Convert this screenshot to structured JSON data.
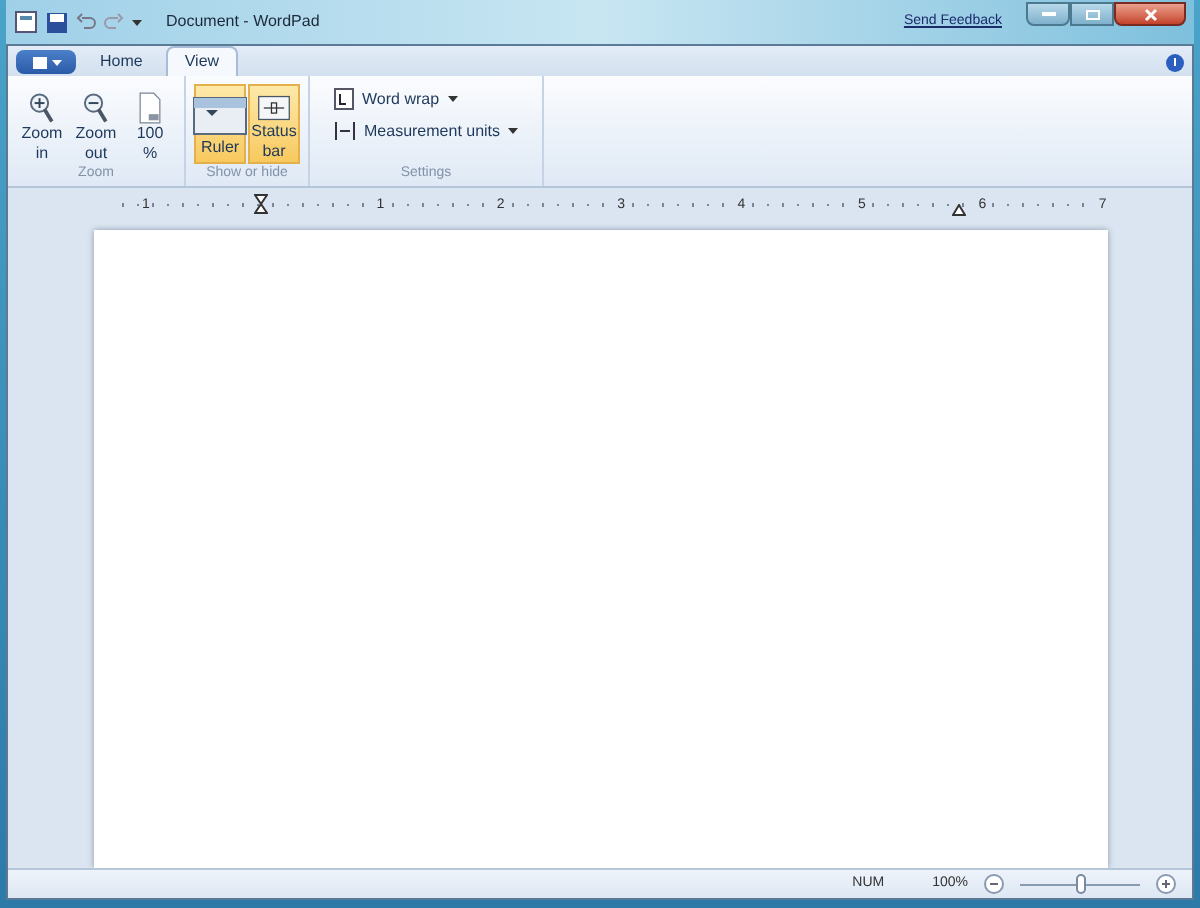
{
  "window": {
    "title": "Document - WordPad",
    "send_feedback": "Send Feedback"
  },
  "tabs": [
    {
      "label": "Home",
      "selected": false
    },
    {
      "label": "View",
      "selected": true
    }
  ],
  "groups": [
    {
      "title": "Zoom",
      "items": [
        {
          "kind": "zoom_in",
          "lines": [
            "Zoom",
            "in"
          ],
          "selected": false
        },
        {
          "kind": "zoom_out",
          "lines": [
            "Zoom",
            "out"
          ],
          "selected": false
        },
        {
          "kind": "page",
          "lines": [
            "100",
            "%"
          ],
          "selected": false
        }
      ]
    },
    {
      "title": "Show or hide",
      "items": [
        {
          "kind": "ruler",
          "lines": [
            "Ruler"
          ],
          "selected": true
        },
        {
          "kind": "status_bar",
          "lines": [
            "Status",
            "bar"
          ],
          "selected": true
        }
      ]
    },
    {
      "title": "Settings",
      "items": [
        {
          "kind": "word_wrap",
          "lines": [
            "Word wrap"
          ],
          "selected": false
        },
        {
          "kind": "measurement",
          "lines": [
            "Measurement units"
          ],
          "selected": false
        }
      ]
    }
  ],
  "ruler": {
    "labels": [
      "1",
      "1",
      "2",
      "3",
      "4",
      "5",
      "6",
      "7"
    ]
  },
  "status_bar": {
    "indicator": "NUM",
    "zoom": "100%",
    "level": 0.5
  }
}
